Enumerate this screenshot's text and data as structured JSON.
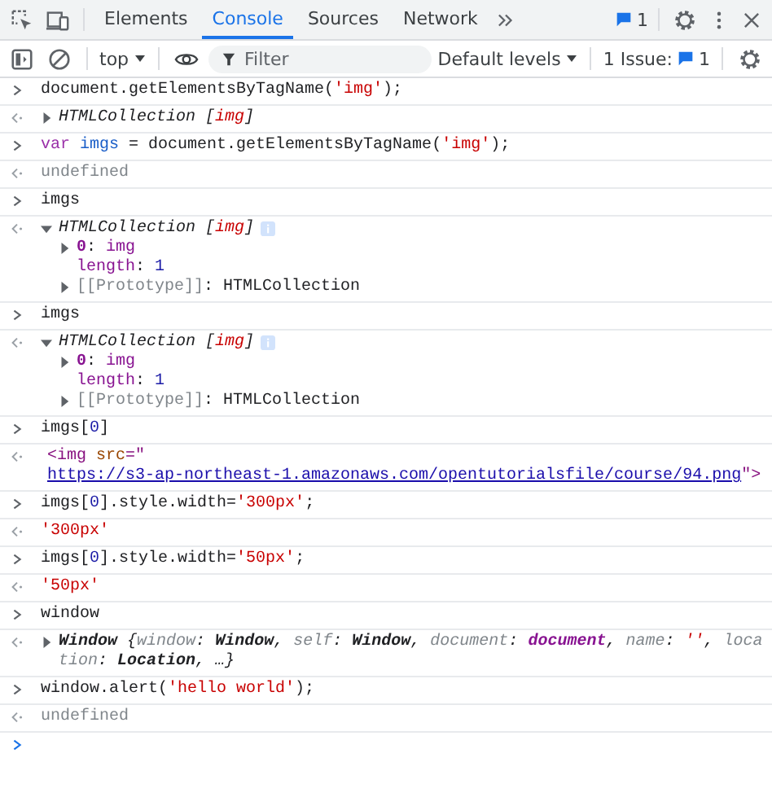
{
  "tabs": [
    {
      "label": "Elements",
      "selected": false
    },
    {
      "label": "Console",
      "selected": true
    },
    {
      "label": "Sources",
      "selected": false
    },
    {
      "label": "Network",
      "selected": false
    }
  ],
  "messages_count": "1",
  "toolbar": {
    "context": "top",
    "filter": {
      "placeholder": "Filter"
    },
    "levels": "Default levels",
    "issues_label": "1 Issue:",
    "issues_count": "1"
  },
  "entries": [
    {
      "kind": "input",
      "segments": [
        {
          "kind": "plain",
          "text": "document.getElementsByTagName("
        },
        {
          "kind": "string",
          "text": "'img'"
        },
        {
          "kind": "plain",
          "text": ");"
        }
      ]
    },
    {
      "kind": "output",
      "expanded": false,
      "segments": [
        {
          "kind": "italic",
          "text": "HTMLCollection ["
        },
        {
          "kind": "italic-string",
          "text": "img"
        },
        {
          "kind": "italic",
          "text": "]"
        }
      ]
    },
    {
      "kind": "input",
      "segments": [
        {
          "kind": "keyword",
          "text": "var "
        },
        {
          "kind": "variable",
          "text": "imgs"
        },
        {
          "kind": "plain",
          "text": " = document.getElementsByTagName("
        },
        {
          "kind": "string",
          "text": "'img'"
        },
        {
          "kind": "plain",
          "text": ");"
        }
      ]
    },
    {
      "kind": "output",
      "segments": [
        {
          "kind": "muted",
          "text": "undefined"
        }
      ]
    },
    {
      "kind": "input",
      "segments": [
        {
          "kind": "plain",
          "text": "imgs"
        }
      ]
    },
    {
      "kind": "output",
      "expanded": true,
      "info": true,
      "segments": [
        {
          "kind": "italic",
          "text": "HTMLCollection ["
        },
        {
          "kind": "italic-string",
          "text": "img"
        },
        {
          "kind": "italic",
          "text": "]"
        }
      ],
      "children": [
        {
          "kind": "node",
          "segments": [
            {
              "kind": "prop",
              "text": "0"
            },
            {
              "kind": "plain",
              "text": ": "
            },
            {
              "kind": "prop-value",
              "text": "img"
            }
          ]
        },
        {
          "kind": "leaf",
          "segments": [
            {
              "kind": "prop-value",
              "text": "length"
            },
            {
              "kind": "plain",
              "text": ": "
            },
            {
              "kind": "number",
              "text": "1"
            }
          ]
        },
        {
          "kind": "node",
          "segments": [
            {
              "kind": "muted",
              "text": "[[Prototype]]"
            },
            {
              "kind": "plain",
              "text": ": HTMLCollection"
            }
          ]
        }
      ]
    },
    {
      "kind": "input",
      "segments": [
        {
          "kind": "plain",
          "text": "imgs"
        }
      ]
    },
    {
      "kind": "output",
      "expanded": true,
      "info": true,
      "segments": [
        {
          "kind": "italic",
          "text": "HTMLCollection ["
        },
        {
          "kind": "italic-string",
          "text": "img"
        },
        {
          "kind": "italic",
          "text": "]"
        }
      ],
      "children": [
        {
          "kind": "node",
          "segments": [
            {
              "kind": "prop",
              "text": "0"
            },
            {
              "kind": "plain",
              "text": ": "
            },
            {
              "kind": "prop-value",
              "text": "img"
            }
          ]
        },
        {
          "kind": "leaf",
          "segments": [
            {
              "kind": "prop-value",
              "text": "length"
            },
            {
              "kind": "plain",
              "text": ": "
            },
            {
              "kind": "number",
              "text": "1"
            }
          ]
        },
        {
          "kind": "node",
          "segments": [
            {
              "kind": "muted",
              "text": "[[Prototype]]"
            },
            {
              "kind": "plain",
              "text": ": HTMLCollection"
            }
          ]
        }
      ]
    },
    {
      "kind": "input",
      "segments": [
        {
          "kind": "plain",
          "text": "imgs["
        },
        {
          "kind": "number",
          "text": "0"
        },
        {
          "kind": "plain",
          "text": "]"
        }
      ]
    },
    {
      "kind": "output",
      "segments": [
        {
          "kind": "tag",
          "text": "<img "
        },
        {
          "kind": "attr",
          "text": "src"
        },
        {
          "kind": "tag",
          "text": "=\""
        },
        {
          "kind": "link",
          "text": "https://s3-ap-northeast-1.amazonaws.com/opentutorialsfile/course/94.png"
        },
        {
          "kind": "tag",
          "text": "\">"
        }
      ]
    },
    {
      "kind": "input",
      "segments": [
        {
          "kind": "plain",
          "text": "imgs["
        },
        {
          "kind": "number",
          "text": "0"
        },
        {
          "kind": "plain",
          "text": "].style.width="
        },
        {
          "kind": "string",
          "text": "'300px'"
        },
        {
          "kind": "plain",
          "text": ";"
        }
      ]
    },
    {
      "kind": "output",
      "segments": [
        {
          "kind": "string",
          "text": "'300px'"
        }
      ]
    },
    {
      "kind": "input",
      "segments": [
        {
          "kind": "plain",
          "text": "imgs["
        },
        {
          "kind": "number",
          "text": "0"
        },
        {
          "kind": "plain",
          "text": "].style.width="
        },
        {
          "kind": "string",
          "text": "'50px'"
        },
        {
          "kind": "plain",
          "text": ";"
        }
      ]
    },
    {
      "kind": "output",
      "segments": [
        {
          "kind": "string",
          "text": "'50px'"
        }
      ]
    },
    {
      "kind": "input",
      "segments": [
        {
          "kind": "plain",
          "text": "window"
        }
      ]
    },
    {
      "kind": "output",
      "expanded": false,
      "segments": [
        {
          "kind": "italic-bold",
          "text": "Window "
        },
        {
          "kind": "italic",
          "text": "{"
        },
        {
          "kind": "italic-key",
          "text": "window"
        },
        {
          "kind": "italic",
          "text": ": "
        },
        {
          "kind": "italic-bold",
          "text": "Window"
        },
        {
          "kind": "italic",
          "text": ", "
        },
        {
          "kind": "italic-key",
          "text": "self"
        },
        {
          "kind": "italic",
          "text": ": "
        },
        {
          "kind": "italic-bold",
          "text": "Window"
        },
        {
          "kind": "italic",
          "text": ", "
        },
        {
          "kind": "italic-key",
          "text": "document"
        },
        {
          "kind": "italic",
          "text": ": "
        },
        {
          "kind": "italic-purple",
          "text": "document"
        },
        {
          "kind": "italic",
          "text": ", "
        },
        {
          "kind": "italic-key",
          "text": "name"
        },
        {
          "kind": "italic",
          "text": ": "
        },
        {
          "kind": "italic-string",
          "text": "''"
        },
        {
          "kind": "italic",
          "text": ", "
        },
        {
          "kind": "italic-key",
          "text": "location"
        },
        {
          "kind": "italic",
          "text": ": "
        },
        {
          "kind": "italic-bold",
          "text": "Location"
        },
        {
          "kind": "italic",
          "text": ", …}"
        }
      ]
    },
    {
      "kind": "input",
      "segments": [
        {
          "kind": "plain",
          "text": "window.alert("
        },
        {
          "kind": "string",
          "text": "'hello world'"
        },
        {
          "kind": "plain",
          "text": ");"
        }
      ]
    },
    {
      "kind": "output",
      "segments": [
        {
          "kind": "muted",
          "text": "undefined"
        }
      ]
    },
    {
      "kind": "prompt"
    }
  ]
}
